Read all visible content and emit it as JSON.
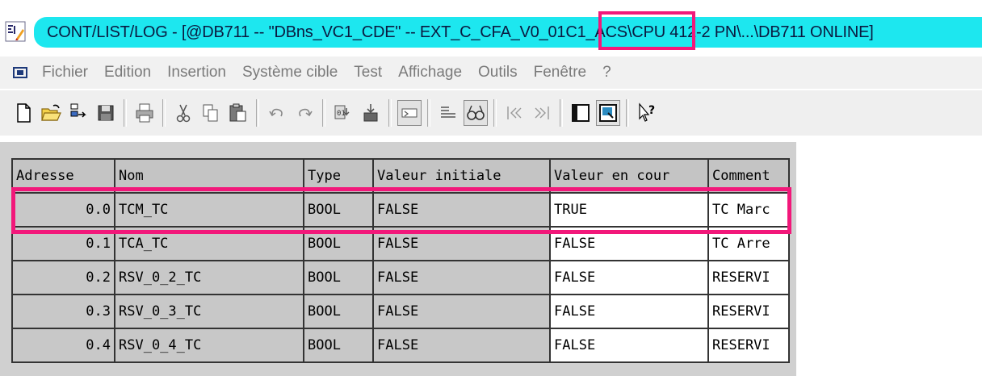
{
  "window": {
    "title": "CONT/LIST/LOG - [@DB711 -- \"DBns_VC1_CDE\" -- EXT_C_CFA_V0_01C1_ACS\\CPU 412-2 PN\\...\\DB711  ONLINE]",
    "highlight_color": "#f2187a",
    "title_bg": "#1de7ef"
  },
  "menu": {
    "items": [
      "Fichier",
      "Edition",
      "Insertion",
      "Système cible",
      "Test",
      "Affichage",
      "Outils",
      "Fenêtre",
      "?"
    ]
  },
  "toolbar": {
    "buttons": [
      {
        "icon": "new-icon"
      },
      {
        "icon": "open-icon"
      },
      {
        "icon": "accessible-nodes-icon"
      },
      {
        "icon": "save-icon"
      },
      {
        "icon": "print-icon"
      },
      {
        "icon": "cut-icon"
      },
      {
        "icon": "copy-icon"
      },
      {
        "icon": "paste-icon"
      },
      {
        "icon": "undo-icon"
      },
      {
        "icon": "redo-icon"
      },
      {
        "icon": "download-icon"
      },
      {
        "icon": "upload-icon"
      },
      {
        "icon": "declaration-view-icon"
      },
      {
        "icon": "data-view-icon"
      },
      {
        "icon": "monitor-icon"
      },
      {
        "icon": "previous-icon"
      },
      {
        "icon": "next-icon"
      },
      {
        "icon": "overview-icon"
      },
      {
        "icon": "details-icon"
      },
      {
        "icon": "help-icon"
      }
    ]
  },
  "table": {
    "headers": [
      "Adresse",
      "Nom",
      "Type",
      "Valeur initiale",
      "Valeur en cour",
      "Comment"
    ],
    "rows": [
      {
        "address": "0.0",
        "name": "TCM_TC",
        "type": "BOOL",
        "initial": "FALSE",
        "current": "TRUE",
        "comment": "TC Marc"
      },
      {
        "address": "0.1",
        "name": "TCA_TC",
        "type": "BOOL",
        "initial": "FALSE",
        "current": "FALSE",
        "comment": "TC Arre"
      },
      {
        "address": "0.2",
        "name": "RSV_0_2_TC",
        "type": "BOOL",
        "initial": "FALSE",
        "current": "FALSE",
        "comment": "RESERVI"
      },
      {
        "address": "0.3",
        "name": "RSV_0_3_TC",
        "type": "BOOL",
        "initial": "FALSE",
        "current": "FALSE",
        "comment": "RESERVI"
      },
      {
        "address": "0.4",
        "name": "RSV_0_4_TC",
        "type": "BOOL",
        "initial": "FALSE",
        "current": "FALSE",
        "comment": "RESERVI"
      }
    ],
    "highlighted_row": 0
  }
}
